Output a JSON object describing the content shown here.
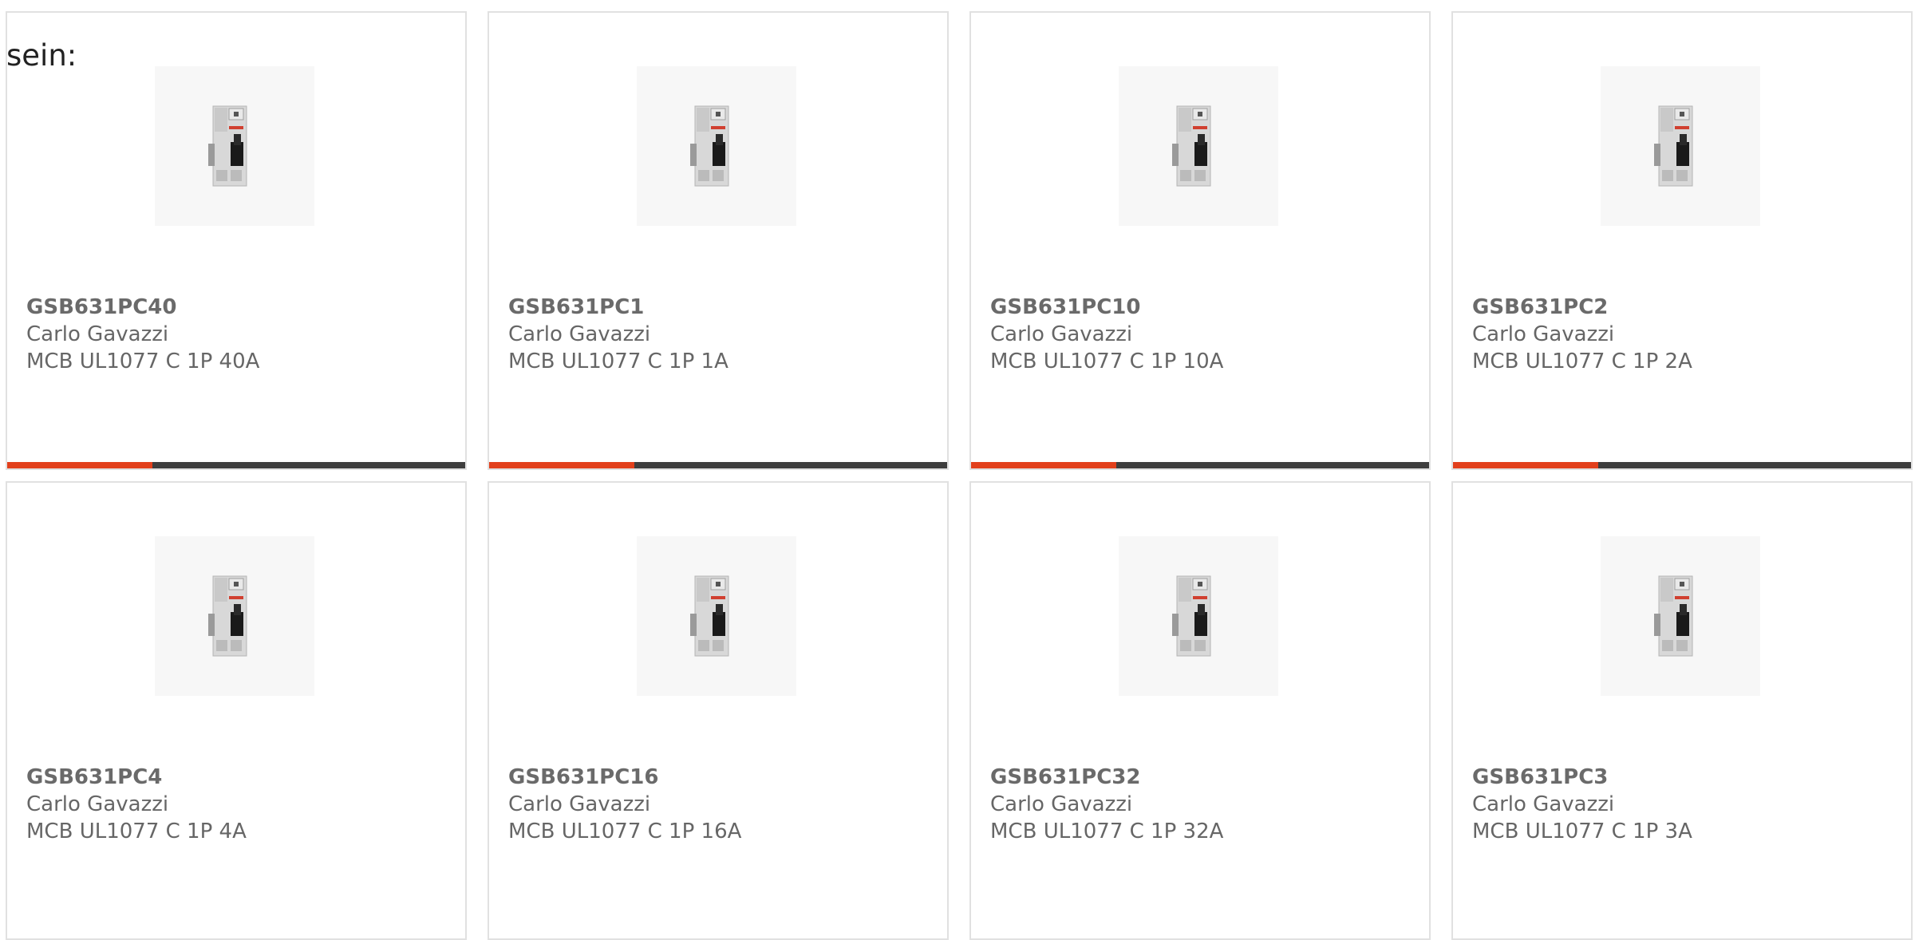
{
  "intro_text": "sein:",
  "products": [
    {
      "sku": "GSB631PC40",
      "brand": "Carlo Gavazzi",
      "description": "MCB UL1077 C 1P 40A"
    },
    {
      "sku": "GSB631PC1",
      "brand": "Carlo Gavazzi",
      "description": "MCB UL1077 C 1P 1A"
    },
    {
      "sku": "GSB631PC10",
      "brand": "Carlo Gavazzi",
      "description": "MCB UL1077 C 1P 10A"
    },
    {
      "sku": "GSB631PC2",
      "brand": "Carlo Gavazzi",
      "description": "MCB UL1077 C 1P 2A"
    },
    {
      "sku": "GSB631PC4",
      "brand": "Carlo Gavazzi",
      "description": "MCB UL1077 C 1P 4A"
    },
    {
      "sku": "GSB631PC16",
      "brand": "Carlo Gavazzi",
      "description": "MCB UL1077 C 1P 16A"
    },
    {
      "sku": "GSB631PC32",
      "brand": "Carlo Gavazzi",
      "description": "MCB UL1077 C 1P 32A"
    },
    {
      "sku": "GSB631PC3",
      "brand": "Carlo Gavazzi",
      "description": "MCB UL1077 C 1P 3A"
    }
  ],
  "colors": {
    "accent": "#e2401c",
    "bar": "#3e3e3e",
    "border": "#e1e1e1",
    "text": "#666666"
  },
  "icons": {
    "product_image": "circuit-breaker-icon"
  }
}
